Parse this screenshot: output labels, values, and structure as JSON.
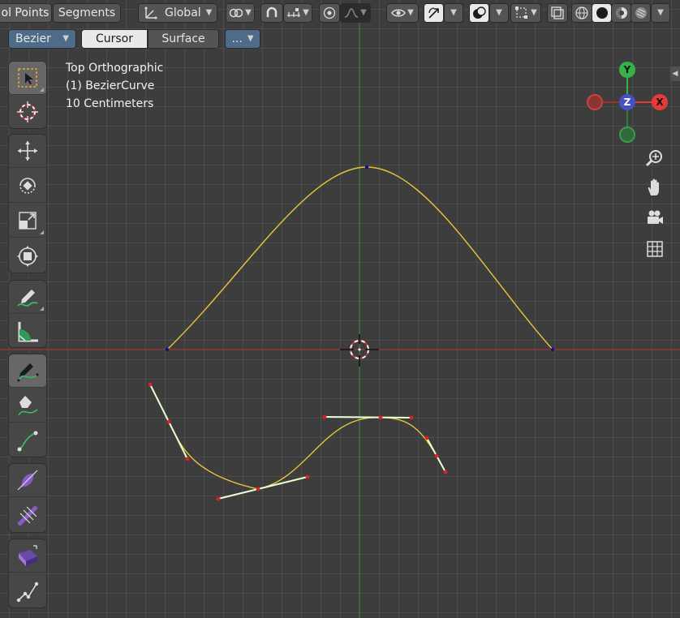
{
  "header": {
    "select_mode_label": "ol Points",
    "segments_label": "Segments",
    "transform_orientation": "Global",
    "curve_type": "Bezier",
    "cursor_label": "Cursor",
    "surface_label": "Surface",
    "more_label": "..."
  },
  "overlay": {
    "view_name": "Top Orthographic",
    "object_name": "(1) BezierCurve",
    "scale": "10 Centimeters"
  },
  "gizmo": {
    "y_label": "Y",
    "z_label": "Z",
    "x_label": "X",
    "x_color": "#e63a3a",
    "y_color": "#37b24a",
    "z_color": "#4452c2"
  },
  "colors": {
    "curve": "#e8c63a",
    "handle": "#e8ffd8",
    "handle_point": "#e02020",
    "control_point": "#10108a",
    "x_axis": "#9a3a3a",
    "y_axis": "#3a7a3a"
  }
}
